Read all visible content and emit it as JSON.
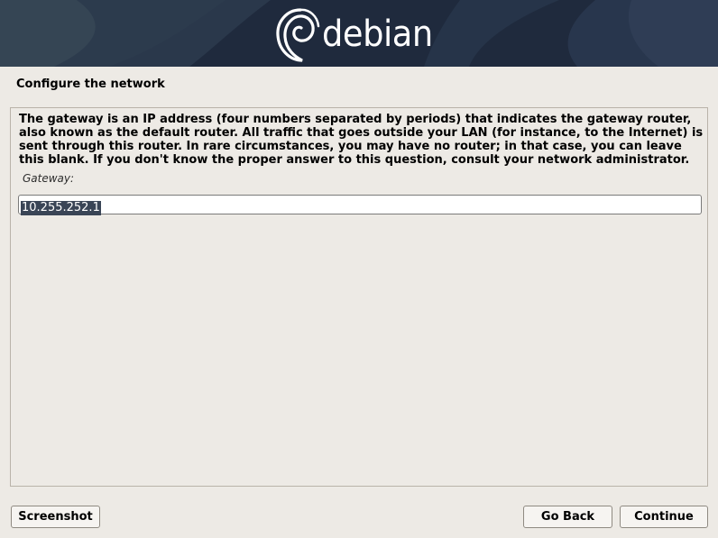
{
  "banner": {
    "logo_text": "debian",
    "logo_icon": "debian-swirl-icon"
  },
  "page": {
    "title": "Configure the network",
    "description": "The gateway is an IP address (four numbers separated by periods) that indicates the gateway router, also known as the default router.  All traffic that goes outside your LAN (for instance, to the Internet) is sent through this router.  In rare circumstances, you may have no router; in that case, you can leave this blank.  If you don't know the proper answer to this question, consult your network administrator."
  },
  "gateway": {
    "label": "Gateway:",
    "value": "10.255.252.1"
  },
  "buttons": {
    "screenshot": "Screenshot",
    "go_back": "Go Back",
    "continue": "Continue"
  },
  "colors": {
    "banner_bg": "#1f2a3d",
    "page_bg": "#edeae5",
    "selection_bg": "#3a4556"
  }
}
